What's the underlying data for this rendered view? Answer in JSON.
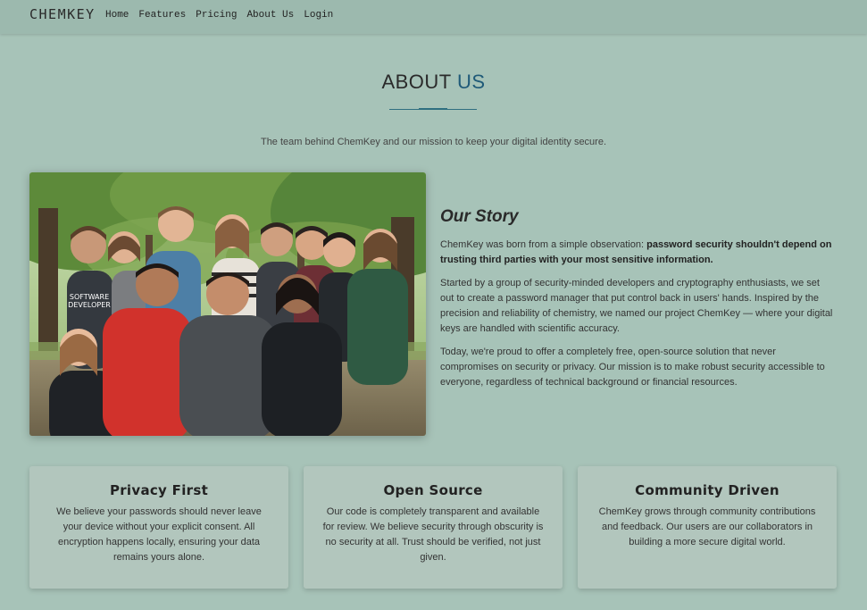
{
  "nav": {
    "logo": "CHEMKEY",
    "links": [
      "Home",
      "Features",
      "Pricing",
      "About Us",
      "Login"
    ]
  },
  "header": {
    "title_main": "ABOUT",
    "title_accent": "US",
    "subtitle": "The team behind ChemKey and our mission to keep your digital identity secure."
  },
  "photo": {
    "shirt_text_line1": "SOFTWARE",
    "shirt_text_line2": "DEVELOPER"
  },
  "story": {
    "title": "Our Story",
    "p1_lead": "ChemKey was born from a simple observation: ",
    "p1_bold": "password security shouldn't depend on trusting third parties with your most sensitive information.",
    "p2": "Started by a group of security-minded developers and cryptography enthusiasts, we set out to create a password manager that put control back in users' hands. Inspired by the precision and reliability of chemistry, we named our project ChemKey — where your digital keys are handled with scientific accuracy.",
    "p3": "Today, we're proud to offer a completely free, open-source solution that never compromises on security or privacy. Our mission is to make robust security accessible to everyone, regardless of technical background or financial resources."
  },
  "values": [
    {
      "title": "Privacy First",
      "text": "We believe your passwords should never leave your device without your explicit consent. All encryption happens locally, ensuring your data remains yours alone."
    },
    {
      "title": "Open Source",
      "text": "Our code is completely transparent and available for review. We believe security through obscurity is no security at all. Trust should be verified, not just given."
    },
    {
      "title": "Community Driven",
      "text": "ChemKey grows through community contributions and feedback. Our users are our collaborators in building a more secure digital world."
    }
  ],
  "colors": {
    "background": "#a7c3b8",
    "navbar": "#9cb9ae",
    "accent": "#1f5a78",
    "card": "#b2c6bd"
  }
}
